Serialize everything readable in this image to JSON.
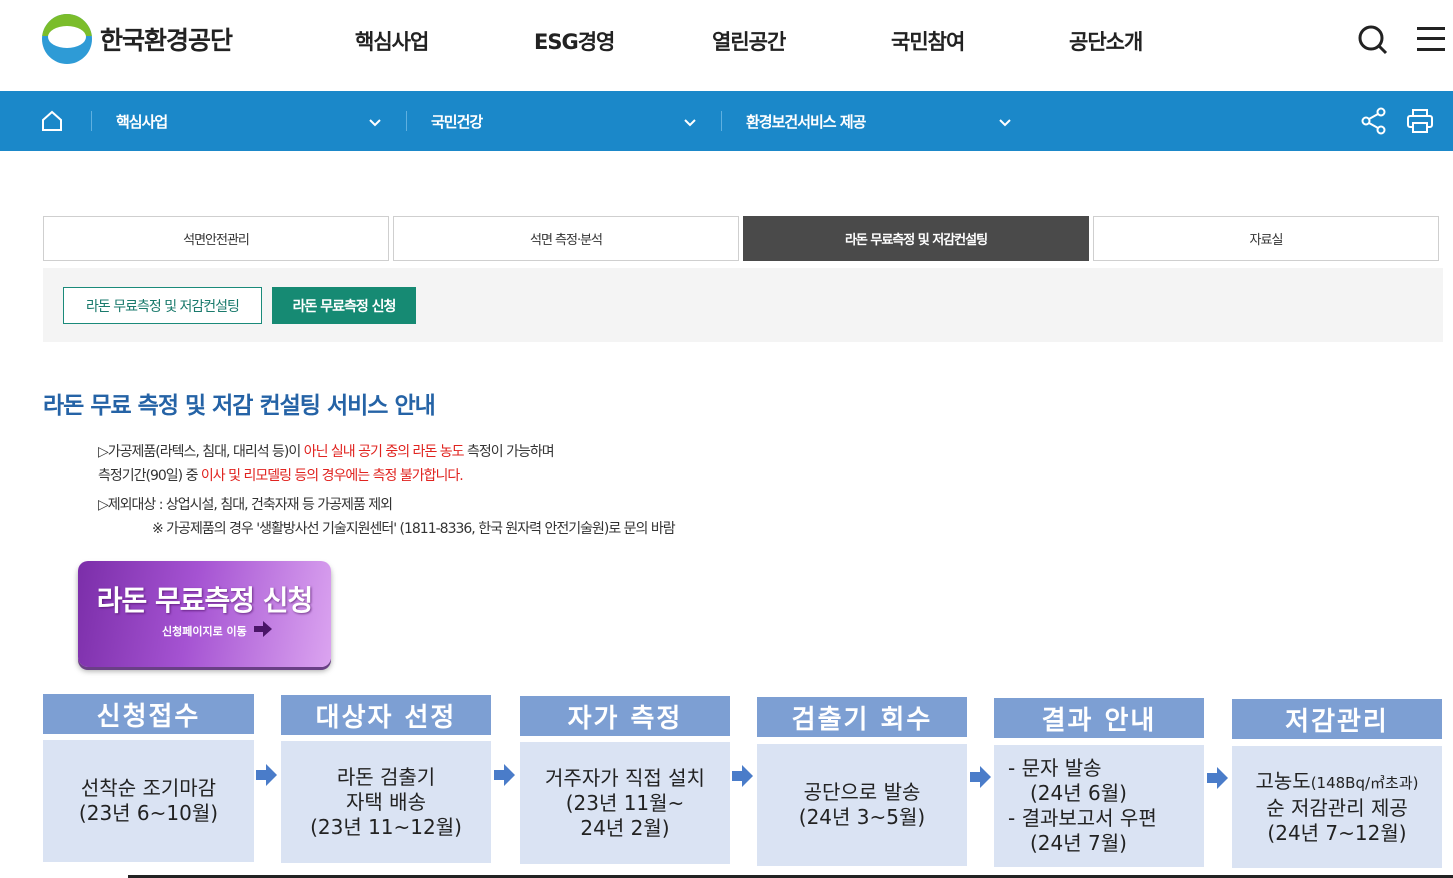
{
  "header": {
    "logo_text": "한국환경공단",
    "gnb": [
      "핵심사업",
      "ESG경영",
      "열린공간",
      "국민참여",
      "공단소개"
    ],
    "search_icon": "search-icon",
    "menu_icon": "hamburger-icon"
  },
  "location": {
    "home_icon": "home-icon",
    "items": [
      "핵심사업",
      "국민건강",
      "환경보건서비스 제공"
    ],
    "share_icon": "share-icon",
    "print_icon": "print-icon"
  },
  "tabs": [
    "석면안전관리",
    "석면 측정·분석",
    "라돈 무료측정 및 저감컨설팅",
    "자료실"
  ],
  "subtabs": [
    "라돈 무료측정 및 저감컨설팅",
    "라돈 무료측정 신청"
  ],
  "content": {
    "title": "라돈 무료 측정 및 저감 컨설팅 서비스 안내",
    "line1_a": "▷가공제품(라텍스, 침대, 대리석 등)이 ",
    "line1_red": "아닌 실내 공기 중의 라돈 농도",
    "line1_b": " 측정이 가능하며",
    "line2_a": "측정기간(90일) 중 ",
    "line2_red": "이사 및 리모델링 등의 경우에는 측정 불가합니다.",
    "line3": "▷제외대상 : 상업시설, 침대, 건축자재 등 가공제품 제외",
    "line4": "※ 가공제품의 경우 '생활방사선 기술지원센터' (1811-8336, 한국 원자력 안전기술원)로 문의 바람"
  },
  "apply_button": {
    "title": "라돈 무료측정 신청",
    "subtitle": "신청페이지로 이동"
  },
  "steps": [
    {
      "head": "신청접수",
      "lines": [
        "선착순 조기마감",
        "(23년 6~10월)"
      ]
    },
    {
      "head": "대상자 선정",
      "lines": [
        "라돈 검출기",
        "자택 배송",
        "(23년 11~12월)"
      ]
    },
    {
      "head": "자가 측정",
      "lines": [
        "거주자가 직접 설치",
        "(23년 11월~",
        "24년 2월)"
      ]
    },
    {
      "head": "검출기 회수",
      "lines": [
        "공단으로 발송",
        "(24년 3~5월)"
      ]
    },
    {
      "head": "결과 안내",
      "lines": [
        "- 문자 발송",
        "(24년 6월)",
        "- 결과보고서 우편",
        "(24년 7월)"
      ]
    },
    {
      "head": "저감관리",
      "lines": [
        "고농도",
        "(148Bq/㎥초과)",
        "순 저감관리 제공",
        "(24년 7~12월)"
      ]
    }
  ],
  "colors": {
    "brand_blue": "#1b88c9",
    "title_blue": "#2563a6",
    "teal": "#168a73",
    "step_head": "#7d9fd3",
    "step_body": "#dae3f3",
    "alert_red": "#e0231f"
  }
}
